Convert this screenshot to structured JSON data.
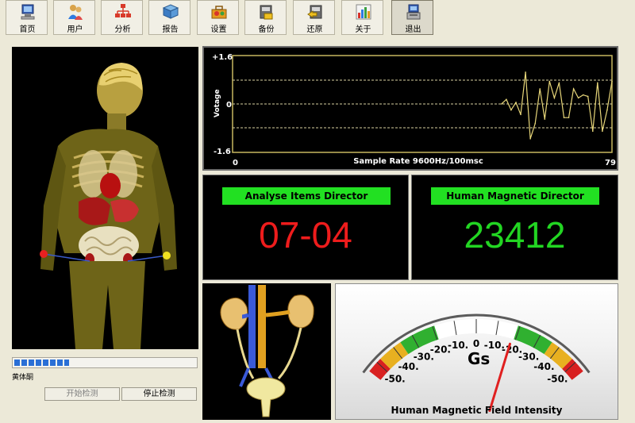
{
  "toolbar": {
    "buttons": [
      {
        "label": "首页",
        "icon": "home-computer-icon"
      },
      {
        "label": "用户",
        "icon": "users-icon"
      },
      {
        "label": "分析",
        "icon": "analysis-tree-icon"
      },
      {
        "label": "报告",
        "icon": "report-book-icon"
      },
      {
        "label": "设置",
        "icon": "settings-toolbox-icon"
      },
      {
        "label": "备份",
        "icon": "backup-icon"
      },
      {
        "label": "还原",
        "icon": "restore-icon"
      },
      {
        "label": "关于",
        "icon": "about-chart-icon"
      },
      {
        "label": "退出",
        "icon": "exit-computer-icon"
      }
    ]
  },
  "left_panel": {
    "progress_percent": 30,
    "status_label": "黄体酮",
    "start_button": "开始检测",
    "stop_button": "停止检测"
  },
  "waveform": {
    "y_max_label": "+1.6",
    "y_zero_label": "0",
    "y_min_label": "-1.6",
    "ylabel": "Votage",
    "x_min_label": "0",
    "x_max_label": "79",
    "xlabel": "Sample Rate 9600Hz/100msc",
    "line_color": "#e8d77a"
  },
  "analyse": {
    "title": "Analyse Items Director",
    "value": "07-04"
  },
  "magnetic": {
    "title": "Human Magnetic Director",
    "value": "23412"
  },
  "gauge": {
    "unit": "Gs",
    "caption": "Human Magnetic Field Intensity",
    "ticks": [
      "-50.",
      "-40.",
      "-30.",
      "-20.",
      "-10.",
      "0",
      "-10.",
      "-20.",
      "-30.",
      "-40.",
      "-50."
    ],
    "needle_value": -18
  },
  "chart_data": {
    "type": "line",
    "xlabel": "Sample Rate 9600Hz/100msc",
    "ylabel": "Votage",
    "xlim": [
      0,
      79
    ],
    "ylim": [
      -1.6,
      1.6
    ],
    "x": [
      56,
      57,
      58,
      59,
      60,
      61,
      62,
      63,
      64,
      65,
      66,
      67,
      68,
      69,
      70,
      71,
      72,
      73,
      74,
      75,
      76,
      77,
      78,
      79
    ],
    "y": [
      0.0,
      0.15,
      -0.2,
      0.05,
      -0.35,
      1.05,
      -1.15,
      -0.65,
      0.5,
      -0.5,
      0.75,
      0.2,
      0.7,
      -0.45,
      -0.45,
      0.5,
      0.2,
      0.3,
      0.25,
      -0.9,
      0.7,
      -0.9,
      -0.2,
      0.75
    ]
  }
}
